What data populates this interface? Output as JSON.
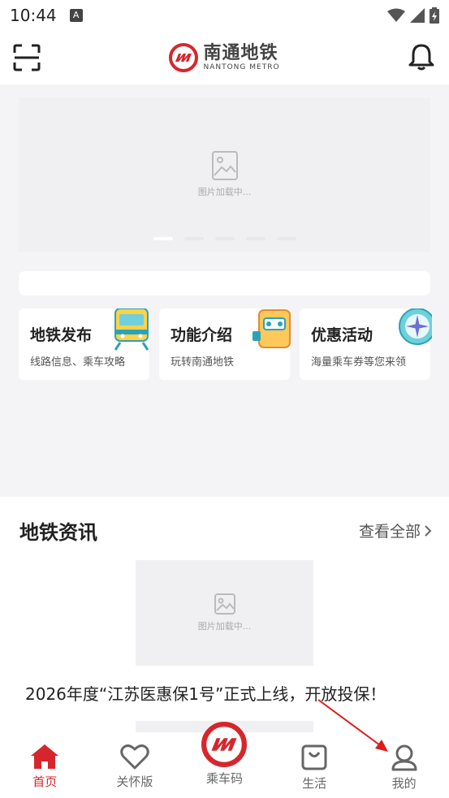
{
  "status": {
    "time": "10:44",
    "notif_icon": "A"
  },
  "header": {
    "logo_cn": "南通地铁",
    "logo_en": "NANTONG METRO"
  },
  "banner": {
    "loading_text": "图片加载中..."
  },
  "cards": [
    {
      "title": "地铁发布",
      "subtitle": "线路信息、乘车攻略",
      "icon": "train-icon"
    },
    {
      "title": "功能介绍",
      "subtitle": "玩转南通地铁",
      "icon": "toolbox-icon"
    },
    {
      "title": "优惠活动",
      "subtitle": "海量乘车券等您来领",
      "icon": "compass-icon"
    }
  ],
  "news": {
    "section_title": "地铁资讯",
    "more_label": "查看全部",
    "loading_text": "图片加载中...",
    "item_title": "2026年度“江苏医惠保1号”正式上线，开放投保！"
  },
  "tabbar": {
    "home": "首页",
    "care": "关怀版",
    "ride_code": "乘车码",
    "life": "生活",
    "mine": "我的"
  },
  "colors": {
    "accent": "#d6262c"
  }
}
